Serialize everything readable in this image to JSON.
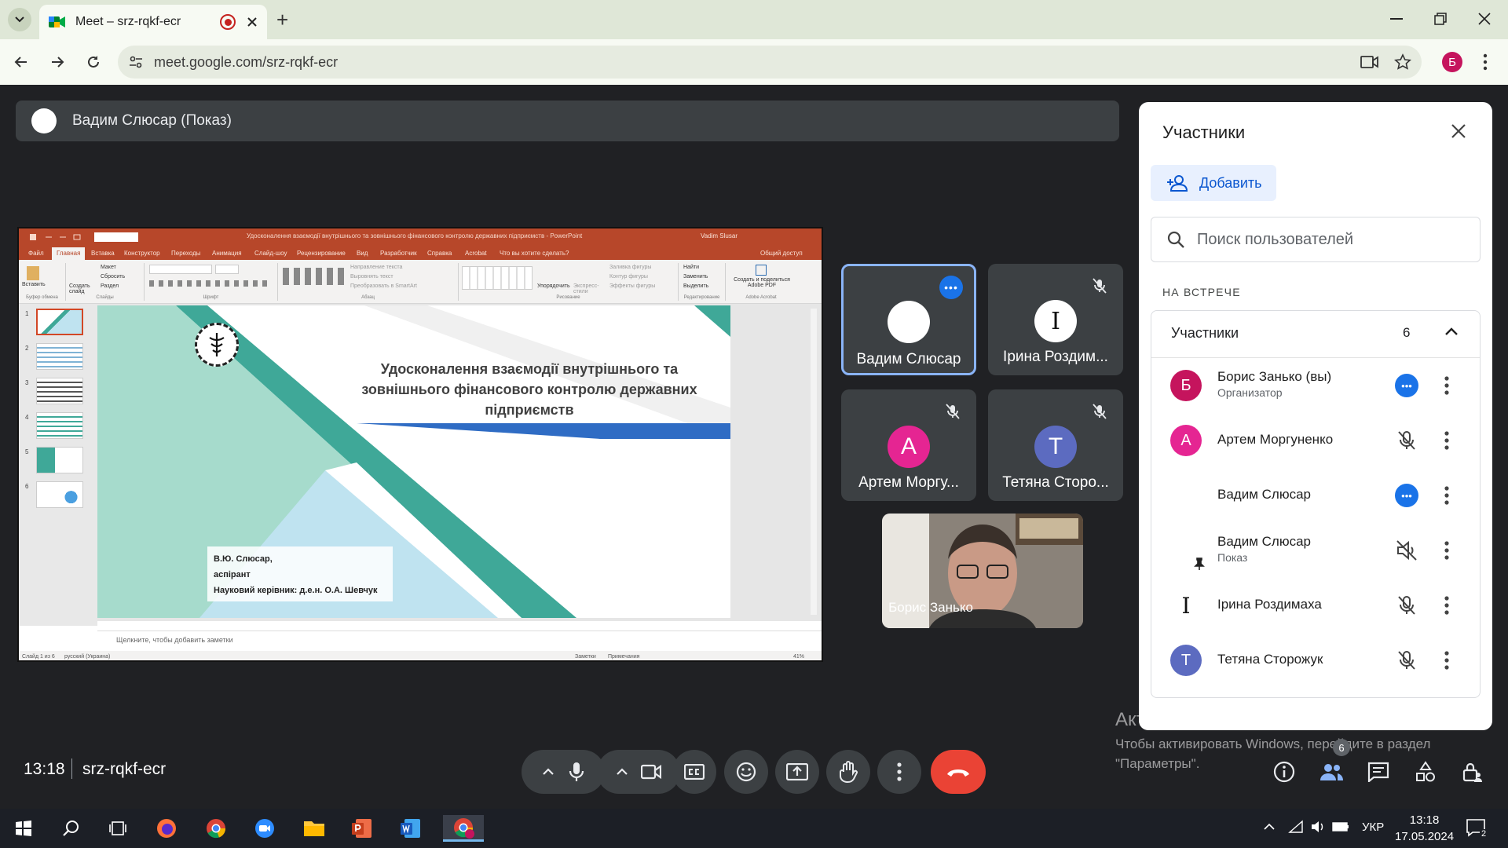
{
  "browser": {
    "tab_title": "Meet – srz-rqkf-ecr",
    "url": "meet.google.com/srz-rqkf-ecr",
    "profile_initial": "Б"
  },
  "presentation_bar": {
    "label": "Вадим Слюсар (Показ)"
  },
  "powerpoint": {
    "window_title": "Удосконалення взаємодії внутрішнього та зовнішнього фінансового контролю державних підприємств - PowerPoint",
    "user": "Vadim Slusar",
    "tabs": [
      "Файл",
      "Главная",
      "Вставка",
      "Конструктор",
      "Переходы",
      "Анимация",
      "Слайд-шоу",
      "Рецензирование",
      "Вид",
      "Разработчик",
      "Справка",
      "Acrobat",
      "Что вы хотите сделать?"
    ],
    "share": "Общий доступ",
    "ribbon_groups": [
      "Буфер обмена",
      "Слайды",
      "Шрифт",
      "Абзац",
      "Рисование",
      "Редактирование",
      "Adobe Acrobat"
    ],
    "ribbon_items": {
      "paste": "Вставить",
      "create": "Создать слайд",
      "layout": "Макет",
      "reset": "Сбросить",
      "section": "Раздел",
      "find": "Найти",
      "replace": "Заменить",
      "select": "Выделить",
      "arrange": "Упорядочить",
      "express": "Экспресс-стили",
      "acrobat": "Создать и поделиться Adobe PDF",
      "text_dir": "Направление текста",
      "align_text": "Выровнять текст",
      "smartart": "Преобразовать в SmartArt",
      "fill": "Заливка фигуры",
      "outline": "Контур фигуры",
      "effects": "Эффекты фигуры"
    },
    "slide_numbers": [
      "1",
      "2",
      "3",
      "4",
      "5",
      "6"
    ],
    "slide_title": "Удосконалення взаємодії внутрішнього та зовнішнього фінансового контролю державних підприємств",
    "slide_author": [
      "В.Ю. Слюсар,",
      "аспірант",
      "Науковий керівник: д.е.н. О.А. Шевчук"
    ],
    "notes_placeholder": "Щелкните, чтобы добавить заметки",
    "status_slide": "Слайд 1 из 6",
    "status_lang": "русский (Украина)",
    "status_notes": "Заметки",
    "status_comments": "Примечания",
    "status_zoom": "41%"
  },
  "tiles": [
    {
      "name": "Вадим Слюсар",
      "initial": "",
      "color": "#ffffff"
    },
    {
      "name": "Ірина Роздим...",
      "initial": "I",
      "color": "#ffffff"
    },
    {
      "name": "Артем Моргу...",
      "initial": "А",
      "color": "#e52592"
    },
    {
      "name": "Тетяна Сторо...",
      "initial": "Т",
      "color": "#5c6bc0"
    },
    {
      "name": "Борис Занько",
      "initial": "",
      "color": "#777777"
    }
  ],
  "panel": {
    "title": "Участники",
    "add_label": "Добавить",
    "search_placeholder": "Поиск пользователей",
    "section_label": "НА ВСТРЕЧЕ",
    "group_label": "Участники",
    "group_count": "6",
    "people": [
      {
        "name": "Борис Занько (вы)",
        "sub": "Организатор",
        "initial": "Б",
        "color": "#c5145d"
      },
      {
        "name": "Артем Моргуненко",
        "sub": "",
        "initial": "А",
        "color": "#e52592"
      },
      {
        "name": "Вадим Слюсар",
        "sub": "",
        "initial": "",
        "color": "#ffffff"
      },
      {
        "name": "Вадим Слюсар",
        "sub": "Показ",
        "initial": "",
        "color": "#ffffff"
      },
      {
        "name": "Ірина Роздимаха",
        "sub": "",
        "initial": "I",
        "color": "#ffffff"
      },
      {
        "name": "Тетяна Сторожук",
        "sub": "",
        "initial": "Т",
        "color": "#5c6bc0"
      }
    ]
  },
  "activation": {
    "title": "Активация Windows",
    "body": "Чтобы активировать Windows, перейдите в раздел \"Параметры\"."
  },
  "meeting": {
    "time": "13:18",
    "code": "srz-rqkf-ecr",
    "people_badge": "6"
  },
  "taskbar": {
    "lang": "УКР",
    "time": "13:18",
    "date": "17.05.2024",
    "notif": "2"
  },
  "colors": {
    "accent": "#1a73e8",
    "hangup": "#ea4335",
    "ppt": "#b7472a",
    "teal": "#3fa898"
  }
}
